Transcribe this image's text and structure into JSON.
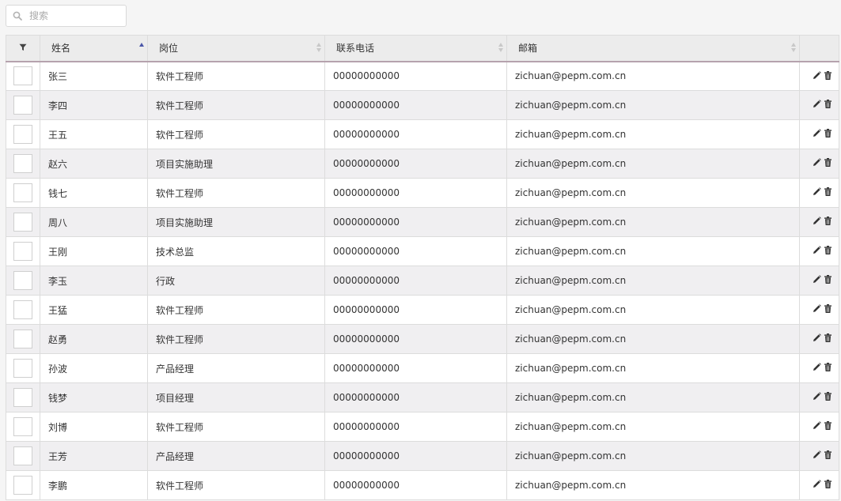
{
  "search": {
    "placeholder": "搜索",
    "value": ""
  },
  "table": {
    "columns": [
      {
        "key": "name",
        "label": "姓名",
        "sort": "asc"
      },
      {
        "key": "position",
        "label": "岗位",
        "sort": "none"
      },
      {
        "key": "phone",
        "label": "联系电话",
        "sort": "none"
      },
      {
        "key": "email",
        "label": "邮箱",
        "sort": "none"
      }
    ],
    "rows": [
      {
        "name": "张三",
        "position": "软件工程师",
        "phone": "00000000000",
        "email": "zichuan@pepm.com.cn"
      },
      {
        "name": "李四",
        "position": "软件工程师",
        "phone": "00000000000",
        "email": "zichuan@pepm.com.cn"
      },
      {
        "name": "王五",
        "position": "软件工程师",
        "phone": "00000000000",
        "email": "zichuan@pepm.com.cn"
      },
      {
        "name": "赵六",
        "position": "项目实施助理",
        "phone": "00000000000",
        "email": "zichuan@pepm.com.cn"
      },
      {
        "name": "钱七",
        "position": "软件工程师",
        "phone": "00000000000",
        "email": "zichuan@pepm.com.cn"
      },
      {
        "name": "周八",
        "position": "项目实施助理",
        "phone": "00000000000",
        "email": "zichuan@pepm.com.cn"
      },
      {
        "name": "王刚",
        "position": "技术总监",
        "phone": "00000000000",
        "email": "zichuan@pepm.com.cn"
      },
      {
        "name": "李玉",
        "position": "行政",
        "phone": "00000000000",
        "email": "zichuan@pepm.com.cn"
      },
      {
        "name": "王猛",
        "position": "软件工程师",
        "phone": "00000000000",
        "email": "zichuan@pepm.com.cn"
      },
      {
        "name": "赵勇",
        "position": "软件工程师",
        "phone": "00000000000",
        "email": "zichuan@pepm.com.cn"
      },
      {
        "name": "孙波",
        "position": "产品经理",
        "phone": "00000000000",
        "email": "zichuan@pepm.com.cn"
      },
      {
        "name": "钱梦",
        "position": "项目经理",
        "phone": "00000000000",
        "email": "zichuan@pepm.com.cn"
      },
      {
        "name": "刘博",
        "position": "软件工程师",
        "phone": "00000000000",
        "email": "zichuan@pepm.com.cn"
      },
      {
        "name": "王芳",
        "position": "产品经理",
        "phone": "00000000000",
        "email": "zichuan@pepm.com.cn"
      },
      {
        "name": "李鹏",
        "position": "软件工程师",
        "phone": "00000000000",
        "email": "zichuan@pepm.com.cn"
      }
    ]
  },
  "icons": {
    "search": "search-icon",
    "filter": "filter-icon",
    "edit": "pencil-icon",
    "delete": "trash-icon"
  },
  "colors": {
    "header_bg": "#ececec",
    "header_underline": "#b6a2ad",
    "row_odd": "#ffffff",
    "row_even": "#f0eff1",
    "sort_active": "#4a56a8"
  }
}
